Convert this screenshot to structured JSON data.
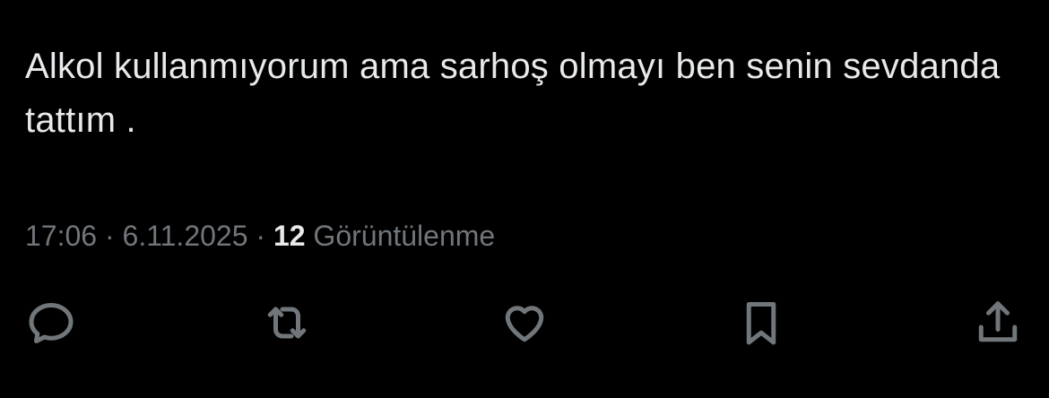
{
  "tweet": {
    "text": "Alkol kullanmıyorum ama sarhoş olmayı ben senin sevdanda tattım ."
  },
  "meta": {
    "time": "17:06",
    "separator": " · ",
    "date": "6.11.2025",
    "views_count": "12",
    "views_label": " Görüntülenme"
  },
  "actions": {
    "icons": [
      "reply-icon",
      "retweet-icon",
      "like-icon",
      "bookmark-icon",
      "share-icon"
    ]
  },
  "colors": {
    "background": "#000000",
    "text_primary": "#e7e9ea",
    "text_secondary": "#71767b"
  }
}
